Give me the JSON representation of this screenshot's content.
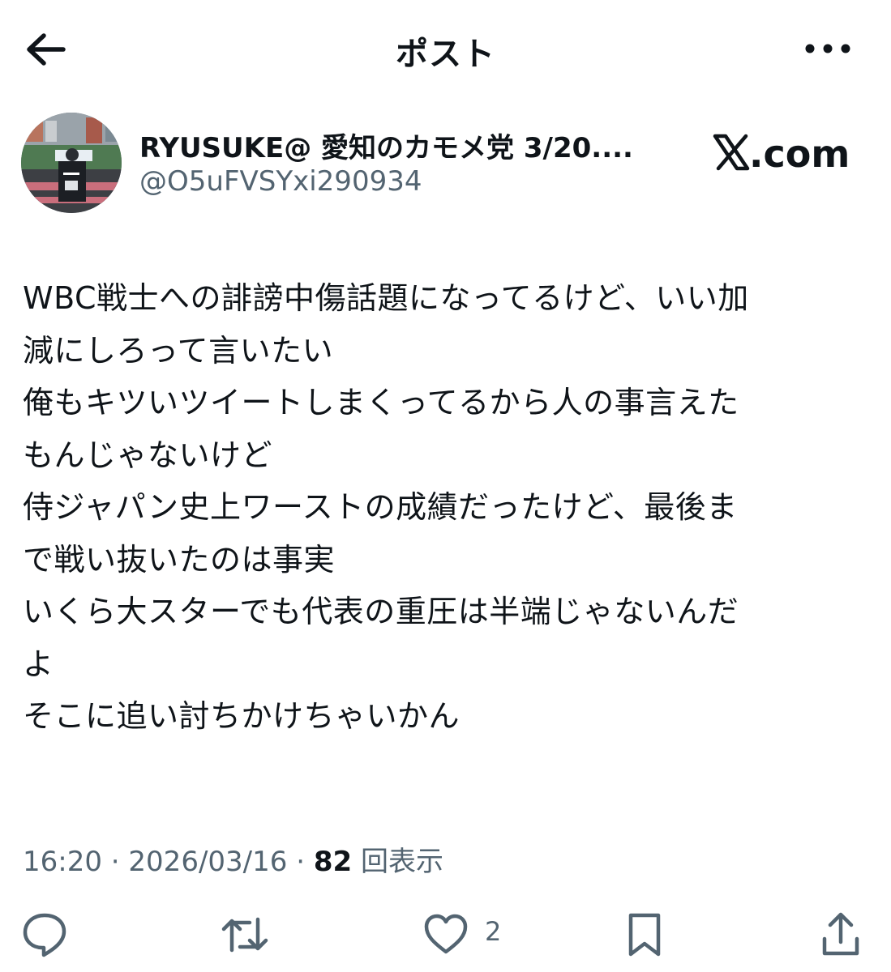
{
  "header": {
    "title": "ポスト"
  },
  "author": {
    "display_name": "RYUSUKE@ 愛知のカモメ党 3/20....",
    "handle": "@O5uFVSYxi290934",
    "source_label": ".com"
  },
  "post": {
    "lines": [
      "WBC戦士への誹謗中傷話題になってるけど、いい加",
      "減にしろって言いたい",
      "俺もキツいツイートしまくってるから人の事言えた",
      "もんじゃないけど",
      "侍ジャパン史上ワーストの成績だったけど、最後ま",
      "で戦い抜いたのは事実",
      "いくら大スターでも代表の重圧は半端じゃないんだ",
      "よ",
      "そこに追い討ちかけちゃいかん"
    ]
  },
  "meta": {
    "time": "16:20",
    "sep1": " · ",
    "date": "2026/03/16",
    "sep2": " · ",
    "views": "82",
    "views_label": " 回表示"
  },
  "actions": {
    "like_count": "2"
  },
  "colors": {
    "text": "#0f1419",
    "secondary": "#536471",
    "icon": "#536471"
  }
}
